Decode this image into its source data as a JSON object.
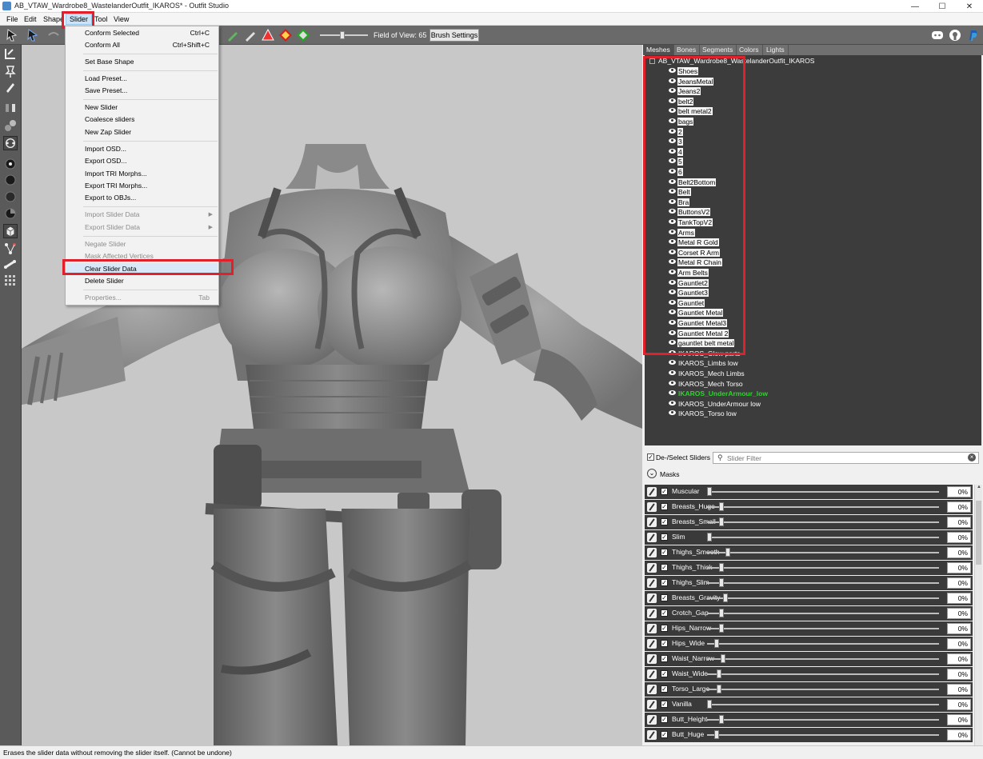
{
  "window": {
    "title": "AB_VTAW_Wardrobe8_WastelanderOutfit_IKAROS* - Outfit Studio",
    "minimize": "—",
    "maximize": "☐",
    "close": "✕"
  },
  "menubar": {
    "items": [
      "File",
      "Edit",
      "Shape",
      "Slider",
      "Tool",
      "View"
    ],
    "active": "Slider"
  },
  "toolbar": {
    "fov_label": "Field of View: 65",
    "brush_settings": "Brush Settings"
  },
  "slider_menu": {
    "items": [
      {
        "label": "Conform Selected",
        "shortcut": "Ctrl+C"
      },
      {
        "label": "Conform All",
        "shortcut": "Ctrl+Shift+C"
      },
      {
        "label": "Set Base Shape",
        "shortcut": ""
      },
      {
        "label": "Load Preset...",
        "shortcut": ""
      },
      {
        "label": "Save Preset...",
        "shortcut": ""
      },
      {
        "label": "New Slider",
        "shortcut": ""
      },
      {
        "label": "Coalesce sliders",
        "shortcut": ""
      },
      {
        "label": "New Zap Slider",
        "shortcut": ""
      },
      {
        "label": "Import OSD...",
        "shortcut": ""
      },
      {
        "label": "Export OSD...",
        "shortcut": ""
      },
      {
        "label": "Import TRI Morphs...",
        "shortcut": ""
      },
      {
        "label": "Export TRI Morphs...",
        "shortcut": ""
      },
      {
        "label": "Export to OBJs...",
        "shortcut": ""
      },
      {
        "label": "Import Slider Data",
        "shortcut": ""
      },
      {
        "label": "Export Slider Data",
        "shortcut": ""
      },
      {
        "label": "Negate Slider",
        "shortcut": ""
      },
      {
        "label": "Mask Affected Vertices",
        "shortcut": ""
      },
      {
        "label": "Clear Slider Data",
        "shortcut": ""
      },
      {
        "label": "Delete Slider",
        "shortcut": ""
      },
      {
        "label": "Properties...",
        "shortcut": "Tab"
      }
    ],
    "highlighted": "Clear Slider Data"
  },
  "panel_tabs": [
    "Meshes",
    "Bones",
    "Segments",
    "Colors",
    "Lights"
  ],
  "mesh_tree": {
    "root": "AB_VTAW_Wardrobe8_WastelanderOutfit_IKAROS",
    "meshes": [
      "Shoes",
      "JeansMetal",
      "Jeans2",
      "belt2",
      "belt metal2",
      "bags",
      "2",
      "3",
      "4",
      "5",
      "6",
      "Belt2Bottom",
      "Belt",
      "Bra",
      "ButtonsV2",
      "TankTopV2",
      "Arms",
      "Metal R Gold",
      "Corset R Arm",
      "Metal R Chain",
      "Arm Belts",
      "Gauntlet2",
      "Gauntlet3",
      "Gauntlet",
      "Gauntlet Metal",
      "Gauntlet Metal3",
      "Gauntlet Metal 2",
      "gauntlet belt metal",
      "IKAROS_Glow parts",
      "IKAROS_Limbs low",
      "IKAROS_Mech Limbs",
      "IKAROS_Mech Torso",
      "IKAROS_UnderArmour_low",
      "IKAROS_UnderArmour low",
      "IKAROS_Torso low"
    ],
    "selected_count": 28,
    "active_mesh": "IKAROS_UnderArmour_low"
  },
  "slider_panel": {
    "deselect_label": "De-/Select Sliders",
    "filter_placeholder": "Slider Filter",
    "masks_label": "Masks",
    "sliders": [
      {
        "name": "Muscular",
        "value": "0%",
        "pos": 0
      },
      {
        "name": "Breasts_Huge",
        "value": "0%",
        "pos": 0.05
      },
      {
        "name": "Breasts_Small",
        "value": "0%",
        "pos": 0.05
      },
      {
        "name": "Slim",
        "value": "0%",
        "pos": 0
      },
      {
        "name": "Thighs_Smooth",
        "value": "0%",
        "pos": 0.08
      },
      {
        "name": "Thighs_Thick",
        "value": "0%",
        "pos": 0.05
      },
      {
        "name": "Thighs_Slim",
        "value": "0%",
        "pos": 0.05
      },
      {
        "name": "Breasts_Gravity",
        "value": "0%",
        "pos": 0.07
      },
      {
        "name": "Crotch_Gap",
        "value": "0%",
        "pos": 0.05
      },
      {
        "name": "Hips_Narrow",
        "value": "0%",
        "pos": 0.05
      },
      {
        "name": "Hips_Wide",
        "value": "0%",
        "pos": 0.03
      },
      {
        "name": "Waist_Narrow",
        "value": "0%",
        "pos": 0.06
      },
      {
        "name": "Waist_Wide",
        "value": "0%",
        "pos": 0.04
      },
      {
        "name": "Torso_Large",
        "value": "0%",
        "pos": 0.04
      },
      {
        "name": "Vanilla",
        "value": "0%",
        "pos": 0
      },
      {
        "name": "Butt_Height",
        "value": "0%",
        "pos": 0.05
      },
      {
        "name": "Butt_Huge",
        "value": "0%",
        "pos": 0.03
      }
    ]
  },
  "status": {
    "text": "Erases the slider data without removing the slider itself. (Cannot be undone)"
  },
  "colors": {
    "highlight_red": "#e0202a",
    "active_mesh_green": "#2bd62b",
    "toolbar_bg": "#6a6a6a",
    "viewport_bg": "#c8c8c8"
  }
}
